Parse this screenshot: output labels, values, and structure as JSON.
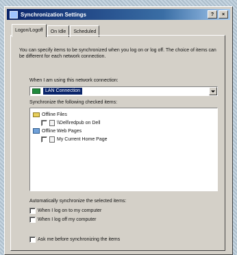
{
  "window": {
    "title": "Synchronization Settings",
    "controls": {
      "help": "?",
      "close": "×"
    }
  },
  "tabs": [
    {
      "label": "Logon/Logoff",
      "active": true
    },
    {
      "label": "On Idle",
      "active": false
    },
    {
      "label": "Scheduled",
      "active": false
    }
  ],
  "intro_text": "You can specify items to be synchronized when you log on or log off. The choice of items can be different for each network connection.",
  "connection": {
    "label": "When I am using this network connection:",
    "selected": "LAN Connection"
  },
  "items": {
    "label": "Synchronize the following checked items:",
    "tree": [
      {
        "label": "Offline Files",
        "icon": "folder-icon",
        "checkbox": false
      },
      {
        "label": "\\\\Dell\\redpub on Dell",
        "icon": "page-icon",
        "checkbox": true,
        "checked": false
      },
      {
        "label": "Offline Web Pages",
        "icon": "web-icon",
        "checkbox": false
      },
      {
        "label": "My Current Home Page",
        "icon": "page-icon",
        "checkbox": true,
        "checked": false
      }
    ]
  },
  "auto": {
    "label": "Automatically synchronize the selected items:",
    "options": [
      {
        "label": "When I log on to my computer",
        "checked": false
      },
      {
        "label": "When I log off my computer",
        "checked": false
      }
    ]
  },
  "ask": {
    "label": "Ask me before synchronizing the items",
    "checked": false
  },
  "colors": {
    "titlebar": "#0a246a",
    "face": "#d4d0c8",
    "selection": "#0a246a"
  }
}
